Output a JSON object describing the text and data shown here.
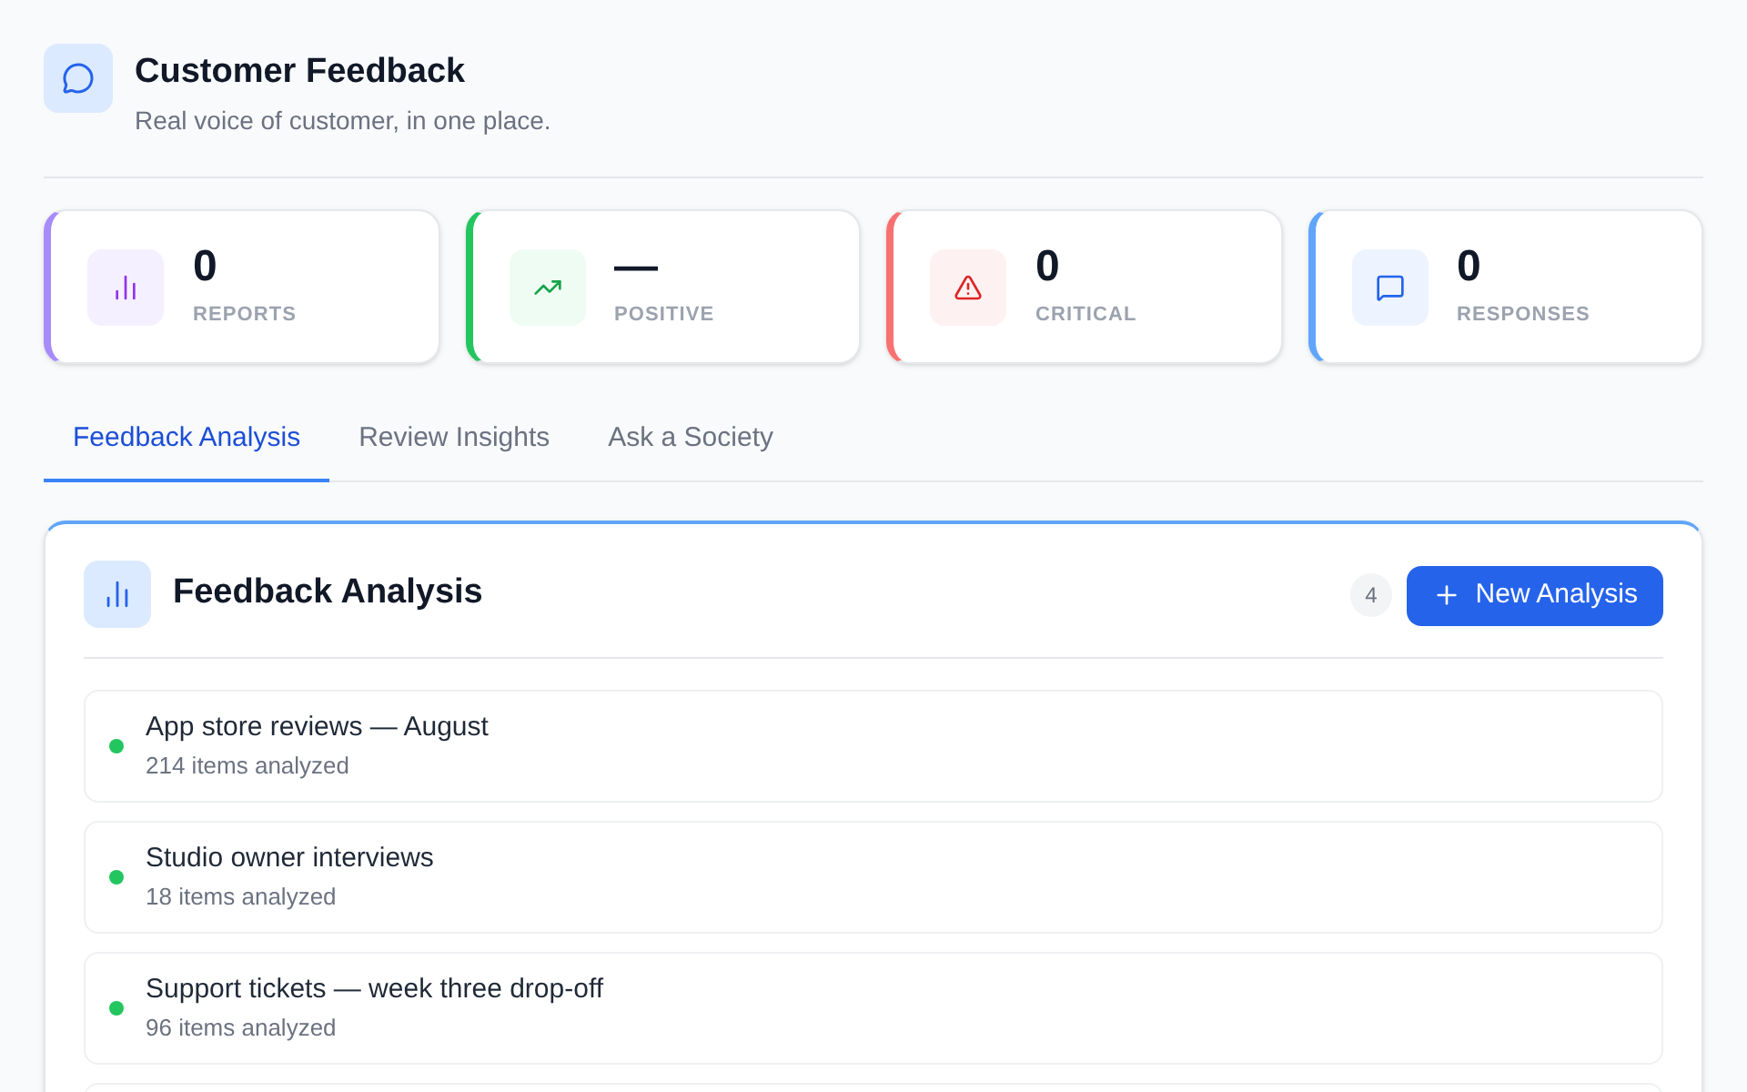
{
  "header": {
    "title": "Customer Feedback",
    "subtitle": "Real voice of customer, in one place."
  },
  "stats": [
    {
      "kind": "chart",
      "color": "#a78bfa",
      "value": "0",
      "label": "REPORTS"
    },
    {
      "kind": "trend",
      "color": "#22c55e",
      "value": "—",
      "label": "POSITIVE"
    },
    {
      "kind": "alert",
      "color": "#f87171",
      "value": "0",
      "label": "CRITICAL"
    },
    {
      "kind": "message",
      "color": "#60a5fa",
      "value": "0",
      "label": "RESPONSES"
    }
  ],
  "tabs": [
    {
      "label": "Feedback Analysis",
      "selected": true
    },
    {
      "label": "Review Insights",
      "selected": false
    },
    {
      "label": "Ask a Society",
      "selected": false
    }
  ],
  "panel": {
    "title": "Feedback Analysis",
    "count": "4",
    "button": "New Analysis",
    "items": [
      {
        "title": "App store reviews — August",
        "meta": "214 items analyzed",
        "color": "#22c55e"
      },
      {
        "title": "Studio owner interviews",
        "meta": "18 items analyzed",
        "color": "#22c55e"
      },
      {
        "title": "Support tickets — week three drop-off",
        "meta": "96 items analyzed",
        "color": "#22c55e"
      }
    ]
  }
}
